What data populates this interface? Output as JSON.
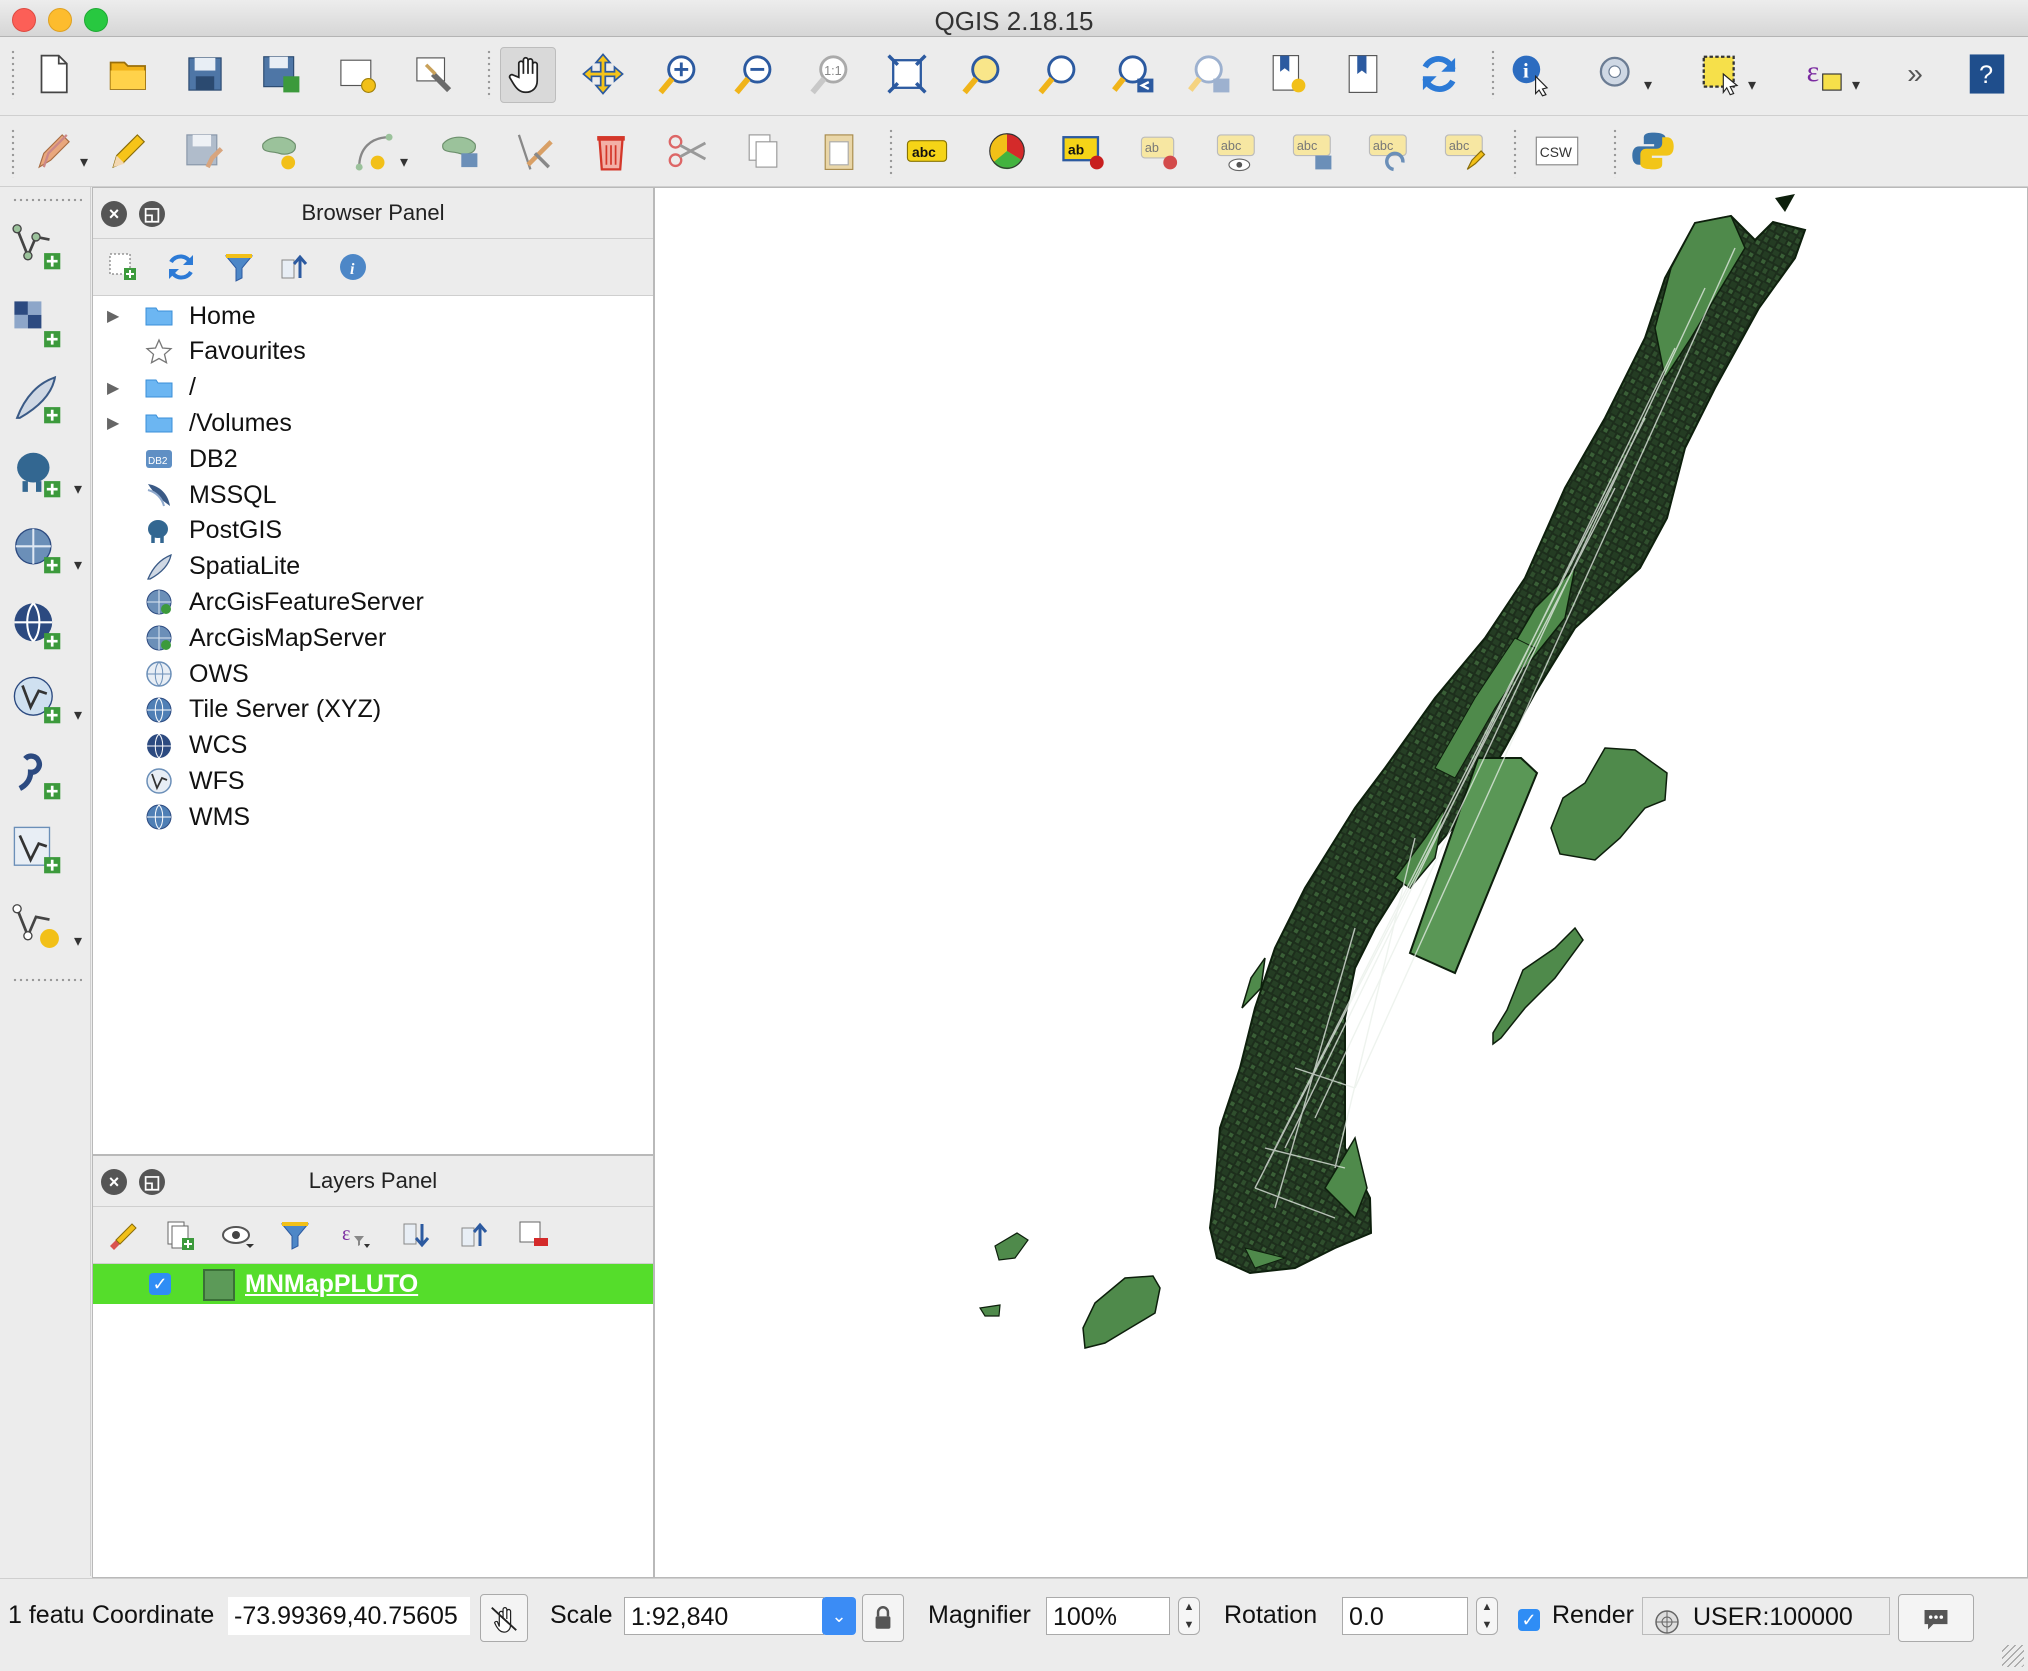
{
  "window": {
    "title": "QGIS 2.18.15"
  },
  "browser_panel": {
    "title": "Browser Panel",
    "items": [
      {
        "label": "Home",
        "icon": "folder-icon",
        "expandable": true
      },
      {
        "label": "Favourites",
        "icon": "star-icon",
        "expandable": false
      },
      {
        "label": "/",
        "icon": "folder-icon",
        "expandable": true
      },
      {
        "label": "/Volumes",
        "icon": "folder-icon",
        "expandable": true
      },
      {
        "label": "DB2",
        "icon": "db2-icon",
        "expandable": false
      },
      {
        "label": "MSSQL",
        "icon": "mssql-icon",
        "expandable": false
      },
      {
        "label": "PostGIS",
        "icon": "postgis-elephant-icon",
        "expandable": false
      },
      {
        "label": "SpatiaLite",
        "icon": "spatialite-feather-icon",
        "expandable": false
      },
      {
        "label": "ArcGisFeatureServer",
        "icon": "arcgis-globe-icon",
        "expandable": false
      },
      {
        "label": "ArcGisMapServer",
        "icon": "arcgis-globe-icon",
        "expandable": false
      },
      {
        "label": "OWS",
        "icon": "ows-globe-icon",
        "expandable": false
      },
      {
        "label": "Tile Server (XYZ)",
        "icon": "xyz-globe-icon",
        "expandable": false
      },
      {
        "label": "WCS",
        "icon": "wcs-globe-icon",
        "expandable": false
      },
      {
        "label": "WFS",
        "icon": "wfs-globe-icon",
        "expandable": false
      },
      {
        "label": "WMS",
        "icon": "wms-globe-icon",
        "expandable": false
      }
    ]
  },
  "layers_panel": {
    "title": "Layers Panel",
    "layers": [
      {
        "name": "MNMapPLUTO",
        "checked": true,
        "fill_color": "#5c9a58",
        "selected": true
      }
    ]
  },
  "map": {
    "fill_color": "#4f8a4b",
    "outline_color": "#0d1f0c"
  },
  "statusbar": {
    "message": "1 featu",
    "coordinate_label": "Coordinate",
    "coordinate_value": "-73.99369,40.75605",
    "scale_label": "Scale",
    "scale_value": "1:92,840",
    "magnifier_label": "Magnifier",
    "magnifier_value": "100%",
    "rotation_label": "Rotation",
    "rotation_value": "0.0",
    "render_label": "Render",
    "render_checked": true,
    "crs_value": "USER:100000"
  },
  "colors": {
    "selection_green": "#55dd2b",
    "accent_blue": "#3b8cf5"
  }
}
